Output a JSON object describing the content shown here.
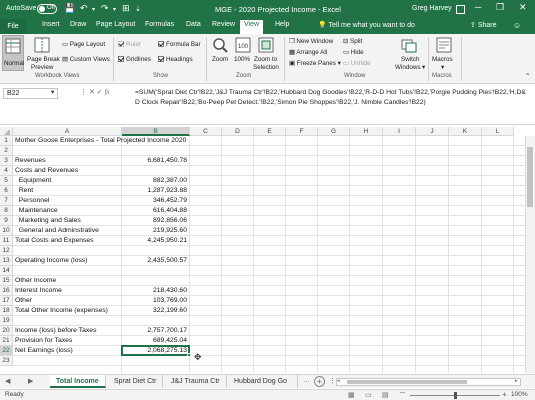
{
  "titlebar": {
    "autosave_label": "AutoSave",
    "autosave_state": "Off",
    "document_title": "MGE - 2020 Projected Income  -  Excel",
    "user": "Greg Harvey"
  },
  "ribbon_tabs": [
    "Insert",
    "Draw",
    "Page Layout",
    "Formulas",
    "Data",
    "Review",
    "View",
    "Help"
  ],
  "file_tab": "File",
  "active_tab": "View",
  "tell_me": "Tell me what you want to do",
  "share_label": "Share",
  "ribbon": {
    "workbook_views": {
      "normal": "Normal",
      "page_break_preview_1": "Page Break",
      "page_break_preview_2": "Preview",
      "page_layout": "Page Layout",
      "custom_views": "Custom Views",
      "label": "Workbook Views"
    },
    "show": {
      "ruler": "Ruler",
      "formula_bar": "Formula Bar",
      "gridlines": "Gridlines",
      "headings": "Headings",
      "label": "Show"
    },
    "zoom": {
      "zoom": "Zoom",
      "zoom100": "100%",
      "zoom_sel_1": "Zoom to",
      "zoom_sel_2": "Selection",
      "label": "Zoom"
    },
    "window": {
      "new_window": "New Window",
      "arrange_all": "Arrange All",
      "freeze_panes": "Freeze Panes",
      "split": "Split",
      "hide": "Hide",
      "unhide": "Unhide",
      "switch_1": "Switch",
      "switch_2": "Windows",
      "label": "Window"
    },
    "macros": {
      "macros": "Macros",
      "label": "Macros"
    }
  },
  "formula_bar": {
    "name_box": "B22",
    "formula": "=SUM('Sprat Diet Ctr'!B22,'J&J Trauma Ctr'!B22,'Hubbard Dog Goodies'!B22,'R-D-D Hot Tubs'!B22,'Porgie Pudding Pies'!B22,'H,D&D Clock Repair'!B22,'Bo-Peep Pet Detect.'!B22,'Simon Pie Shoppes'!B22,'J. Nimble Candles'!B22)"
  },
  "columns": [
    "A",
    "B",
    "C",
    "D",
    "E",
    "F",
    "G",
    "H",
    "I",
    "J",
    "K",
    "L"
  ],
  "rows": [
    {
      "n": "1",
      "a": "Mother Goose Enterprises - Total Projected Income 2020",
      "b": ""
    },
    {
      "n": "2",
      "a": "",
      "b": ""
    },
    {
      "n": "3",
      "a": "Revenues",
      "b": "6,681,450.78"
    },
    {
      "n": "4",
      "a": "Costs and Revenues",
      "b": ""
    },
    {
      "n": "5",
      "a": "  Equipment",
      "b": "882,387.00"
    },
    {
      "n": "6",
      "a": "  Rent",
      "b": "1,287,923.88"
    },
    {
      "n": "7",
      "a": "  Personnel",
      "b": "346,452.79"
    },
    {
      "n": "8",
      "a": "  Maintenance",
      "b": "616,404.88"
    },
    {
      "n": "9",
      "a": "  Marketing and Sales",
      "b": "892,856.06"
    },
    {
      "n": "10",
      "a": "  General and Adminstrative",
      "b": "219,925.60"
    },
    {
      "n": "11",
      "a": "Total Costs and Expenses",
      "b": "4,245,950.21"
    },
    {
      "n": "12",
      "a": "",
      "b": ""
    },
    {
      "n": "13",
      "a": "Operating Income (loss)",
      "b": "2,435,500.57"
    },
    {
      "n": "14",
      "a": "",
      "b": ""
    },
    {
      "n": "15",
      "a": "Other Income",
      "b": ""
    },
    {
      "n": "16",
      "a": "Interest Income",
      "b": "218,430.60"
    },
    {
      "n": "17",
      "a": "Other",
      "b": "103,769.00"
    },
    {
      "n": "18",
      "a": "Total Other Income (expenses)",
      "b": "322,199.60"
    },
    {
      "n": "19",
      "a": "",
      "b": ""
    },
    {
      "n": "20",
      "a": "Income (loss) before Taxes",
      "b": "2,757,700.17"
    },
    {
      "n": "21",
      "a": "Provision for Taxes",
      "b": "689,425.04"
    },
    {
      "n": "22",
      "a": "Net Earnings (loss)",
      "b": "2,068,275.13"
    },
    {
      "n": "23",
      "a": "",
      "b": ""
    }
  ],
  "sheet_tabs": [
    "Total Income",
    "Sprat Diet Ctr",
    "J&J Trauma Ctr",
    "Hubbard Dog Go ..."
  ],
  "status": {
    "ready": "Ready",
    "zoom": "100%"
  },
  "colors": {
    "brand": "#217346"
  }
}
